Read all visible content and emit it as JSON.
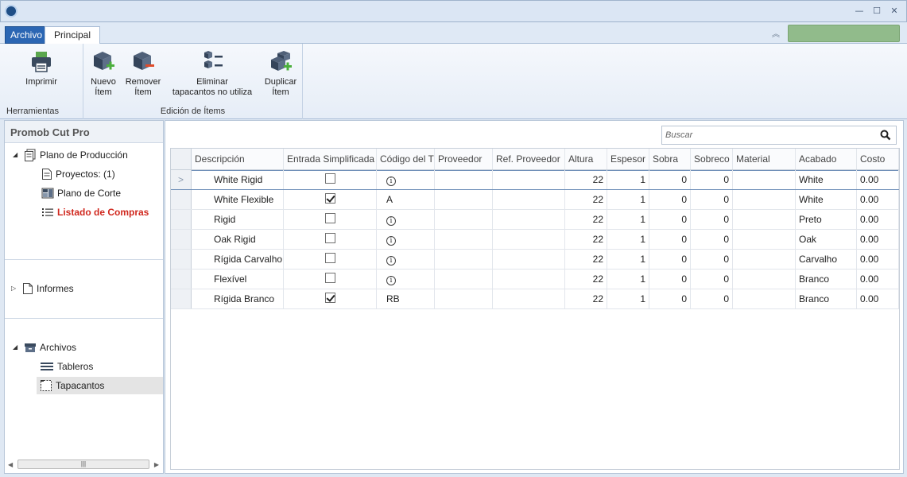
{
  "window": {
    "min": "—",
    "max": "☐",
    "close": "✕"
  },
  "ribbon_tabs": [
    "Archivo",
    "Principal"
  ],
  "ribbon": {
    "groups": [
      {
        "label": "Herramientas",
        "buttons": [
          {
            "label1": "Imprimir",
            "label2": ""
          }
        ]
      },
      {
        "label": "Edición de Ítems",
        "buttons": [
          {
            "label1": "Nuevo",
            "label2": "Ítem"
          },
          {
            "label1": "Remover",
            "label2": "Ítem"
          },
          {
            "label1": "Eliminar",
            "label2": "tapacantos no utiliza"
          },
          {
            "label1": "Duplicar",
            "label2": "Ítem"
          }
        ]
      }
    ]
  },
  "left_panel": {
    "title": "Promob Cut Pro",
    "tree": {
      "plano_produccion": "Plano de Producción",
      "proyectos": "Proyectos: (1)",
      "plano_corte": "Plano de Corte",
      "listado_compras": "Listado de Compras",
      "informes": "Informes",
      "archivos": "Archivos",
      "tableros": "Tableros",
      "tapacantos": "Tapacantos"
    }
  },
  "search": {
    "placeholder": "Buscar"
  },
  "grid": {
    "columns": [
      "Descripción",
      "Entrada Simplificada",
      "Código del T",
      "Proveedor",
      "Ref. Proveedor",
      "Altura",
      "Espesor",
      "Sobra",
      "Sobreco",
      "Material",
      "Acabado",
      "Costo"
    ],
    "current_row_marker": ">",
    "rows": [
      {
        "desc": "White Rigid",
        "simplificada": false,
        "codigo": "",
        "info": true,
        "proveedor": "",
        "ref": "",
        "altura": "22",
        "espesor": "1",
        "sobra": "0",
        "sobreco": "0",
        "material": "",
        "acabado": "White",
        "costo": "0.00"
      },
      {
        "desc": "White Flexible",
        "simplificada": true,
        "codigo": "A",
        "info": false,
        "proveedor": "",
        "ref": "",
        "altura": "22",
        "espesor": "1",
        "sobra": "0",
        "sobreco": "0",
        "material": "",
        "acabado": "White",
        "costo": "0.00"
      },
      {
        "desc": "Rigid",
        "simplificada": false,
        "codigo": "",
        "info": true,
        "proveedor": "",
        "ref": "",
        "altura": "22",
        "espesor": "1",
        "sobra": "0",
        "sobreco": "0",
        "material": "",
        "acabado": "Preto",
        "costo": "0.00"
      },
      {
        "desc": "Oak Rigid",
        "simplificada": false,
        "codigo": "",
        "info": true,
        "proveedor": "",
        "ref": "",
        "altura": "22",
        "espesor": "1",
        "sobra": "0",
        "sobreco": "0",
        "material": "",
        "acabado": "Oak",
        "costo": "0.00"
      },
      {
        "desc": "Rígida Carvalho",
        "simplificada": false,
        "codigo": "",
        "info": true,
        "proveedor": "",
        "ref": "",
        "altura": "22",
        "espesor": "1",
        "sobra": "0",
        "sobreco": "0",
        "material": "",
        "acabado": "Carvalho",
        "costo": "0.00"
      },
      {
        "desc": "Flexível",
        "simplificada": false,
        "codigo": "",
        "info": true,
        "proveedor": "",
        "ref": "",
        "altura": "22",
        "espesor": "1",
        "sobra": "0",
        "sobreco": "0",
        "material": "",
        "acabado": "Branco",
        "costo": "0.00"
      },
      {
        "desc": "Rígida Branco",
        "simplificada": true,
        "codigo": "RB",
        "info": false,
        "proveedor": "",
        "ref": "",
        "altura": "22",
        "espesor": "1",
        "sobra": "0",
        "sobreco": "0",
        "material": "",
        "acabado": "Branco",
        "costo": "0.00"
      }
    ]
  },
  "colors": {
    "accent": "#2b66b3",
    "highlight_text": "#d0281e",
    "status_green": "#91bb8b"
  }
}
